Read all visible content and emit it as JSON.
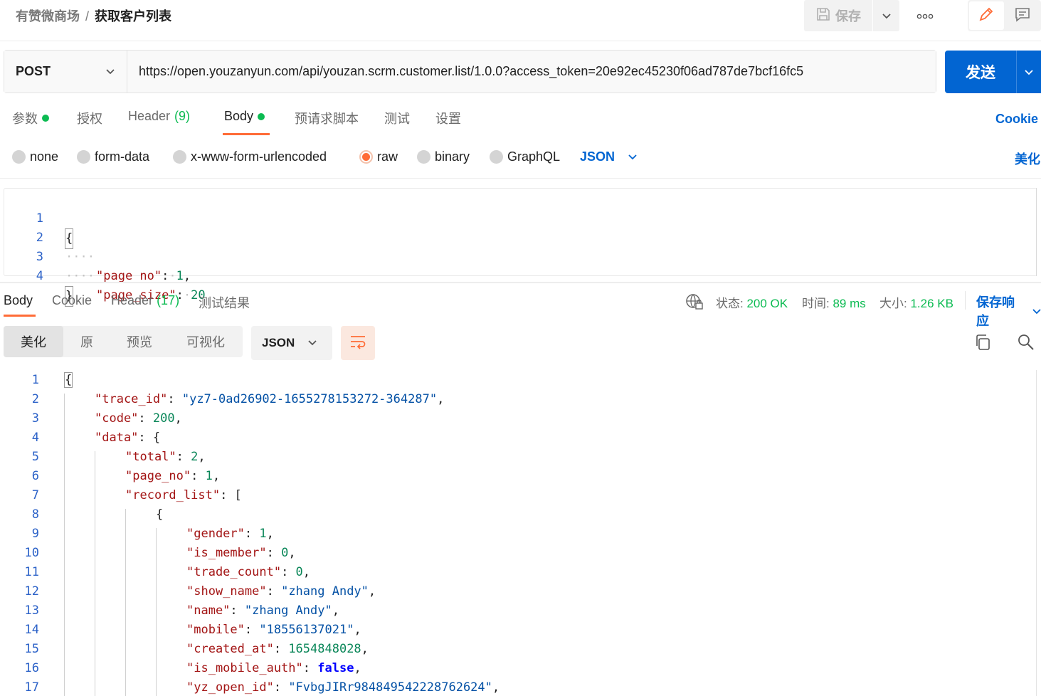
{
  "breadcrumb": {
    "parent": "有赞微商场",
    "separator": "/",
    "current": "获取客户列表"
  },
  "toolbar": {
    "save_label": "保存"
  },
  "request": {
    "method": "POST",
    "url": "https://open.youzanyun.com/api/youzan.scrm.customer.list/1.0.0?access_token=20e92ec45230f06ad787de7bcf16fc5",
    "send_label": "发送"
  },
  "req_tabs": {
    "params": "参数",
    "auth": "授权",
    "headers": "Header",
    "headers_count": "(9)",
    "body": "Body",
    "pre_script": "预请求脚本",
    "tests": "测试",
    "settings": "设置",
    "cookies": "Cookie"
  },
  "body_types": {
    "none": "none",
    "form_data": "form-data",
    "urlencoded": "x-www-form-urlencoded",
    "raw": "raw",
    "binary": "binary",
    "graphql": "GraphQL",
    "language": "JSON",
    "beautify": "美化"
  },
  "request_body": {
    "line_numbers": [
      "1",
      "2",
      "3",
      "4"
    ],
    "lines": [
      [
        "{"
      ],
      [
        "\"page_no\"",
        ":",
        "1",
        ","
      ],
      [
        "\"page_size\"",
        ":",
        "20"
      ],
      [
        "}"
      ]
    ]
  },
  "response_tabs": {
    "body": "Body",
    "cookies": "Cookie",
    "headers": "Header",
    "headers_count": "(17)",
    "test_results": "测试结果"
  },
  "response_meta": {
    "status_label": "状态:",
    "status_value": "200 OK",
    "time_label": "时间:",
    "time_value": "89 ms",
    "size_label": "大小:",
    "size_value": "1.26 KB",
    "save_response": "保存响应"
  },
  "response_views": {
    "pretty": "美化",
    "raw": "原",
    "preview": "预览",
    "visualize": "可视化",
    "format": "JSON"
  },
  "response_body": {
    "line_numbers": [
      "1",
      "2",
      "3",
      "4",
      "5",
      "6",
      "7",
      "8",
      "9",
      "10",
      "11",
      "12",
      "13",
      "14",
      "15",
      "16",
      "17"
    ],
    "l1": "{",
    "l2_key": "\"trace_id\"",
    "l2_val": "\"yz7-0ad26902-1655278153272-364287\"",
    "l3_key": "\"code\"",
    "l3_val": "200",
    "l4_key": "\"data\"",
    "l4_val": "{",
    "l5_key": "\"total\"",
    "l5_val": "2",
    "l6_key": "\"page_no\"",
    "l6_val": "1",
    "l7_key": "\"record_list\"",
    "l7_val": "[",
    "l8": "{",
    "l9_key": "\"gender\"",
    "l9_val": "1",
    "l10_key": "\"is_member\"",
    "l10_val": "0",
    "l11_key": "\"trade_count\"",
    "l11_val": "0",
    "l12_key": "\"show_name\"",
    "l12_val": "\"zhang Andy\"",
    "l13_key": "\"name\"",
    "l13_val": "\"zhang Andy\"",
    "l14_key": "\"mobile\"",
    "l14_val": "\"18556137021\"",
    "l15_key": "\"created_at\"",
    "l15_val": "1654848028",
    "l16_key": "\"is_mobile_auth\"",
    "l16_val": "false",
    "l17_key": "\"yz_open_id\"",
    "l17_val": "\"FvbgJIRr984849542228762624\""
  },
  "icons": {
    "save": "save-icon",
    "more": "more-icon",
    "edit": "pencil-icon",
    "comments": "comment-icon",
    "send_caret": "chevron-down-icon",
    "globe": "globe-lock-icon",
    "wrap": "wrap-lines-icon",
    "copy": "copy-icon",
    "search": "search-icon"
  },
  "colors": {
    "accent_blue": "#0265d2",
    "accent_orange": "#ff6c37",
    "status_green": "#0cbb52"
  }
}
